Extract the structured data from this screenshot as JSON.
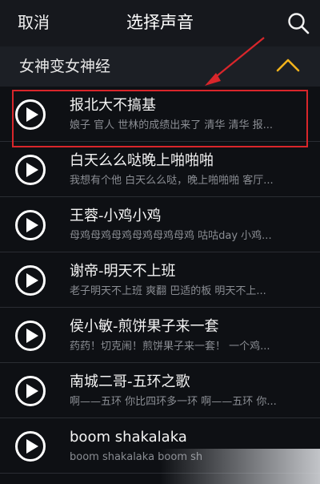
{
  "navbar": {
    "cancel_label": "取消",
    "title": "选择声音",
    "search_icon": "search-icon"
  },
  "category": {
    "label": "女神变女神经",
    "collapse_icon": "chevron-up-icon"
  },
  "colors": {
    "accent": "#f2b21b",
    "highlight": "#d9262b",
    "background": "#0e1014"
  },
  "sounds": [
    {
      "title": "报北大不搞基",
      "lyrics": "娘子 官人 世林的成绩出来了 清华 清华 报..."
    },
    {
      "title": "白天么么哒晚上啪啪啪",
      "lyrics": "我想有个他 白天么么哒，晚上啪啪啪 客厅..."
    },
    {
      "title": "王蓉-小鸡小鸡",
      "lyrics": "母鸡母鸡母鸡母鸡母鸡母鸡  咕咕day  小鸡..."
    },
    {
      "title": "谢帝-明天不上班",
      "lyrics": "老子明天不上班 爽翻 巴适的板 明天不上..."
    },
    {
      "title": "侯小敏-煎饼果子来一套",
      "lyrics": "药药！切克闹！煎饼果子来一套！  一个鸡..."
    },
    {
      "title": "南城二哥-五环之歌",
      "lyrics": "啊——五环 你比四环多一环 啊——五环 你..."
    },
    {
      "title": "boom shakalaka",
      "lyrics": "boom shakalaka boom sh"
    }
  ]
}
